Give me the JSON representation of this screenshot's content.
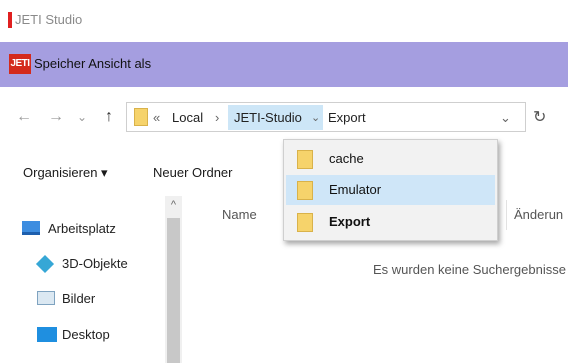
{
  "window": {
    "title": "JETI Studio"
  },
  "dialog": {
    "title": "Speicher Ansicht als",
    "logo_text": "JETI"
  },
  "nav": {
    "back": "←",
    "forward": "→",
    "history": "⌄",
    "up": "↑",
    "refresh": "↻"
  },
  "address": {
    "overflow": "«",
    "crumbs": [
      "Local",
      "JETI-Studio",
      "Export"
    ],
    "separator": "›",
    "dropdown_arrow": "⌄"
  },
  "toolbar": {
    "organize": "Organisieren ▾",
    "new_folder": "Neuer Ordner"
  },
  "sidebar": {
    "items": [
      {
        "label": "Arbeitsplatz",
        "icon": "computer-icon"
      },
      {
        "label": "3D-Objekte",
        "icon": "cube-icon"
      },
      {
        "label": "Bilder",
        "icon": "pictures-icon"
      },
      {
        "label": "Desktop",
        "icon": "desktop-icon"
      }
    ]
  },
  "columns": {
    "name": "Name",
    "changed": "Änderun"
  },
  "content": {
    "empty": "Es wurden keine Suchergebnisse"
  },
  "dropdown": {
    "items": [
      {
        "label": "cache",
        "selected": false,
        "bold": false
      },
      {
        "label": "Emulator",
        "selected": true,
        "bold": false
      },
      {
        "label": "Export",
        "selected": false,
        "bold": true
      }
    ]
  },
  "colors": {
    "header_purple": "#a59ee0",
    "selection_blue": "#cfe6f8",
    "jeti_red": "#d42a1c"
  }
}
